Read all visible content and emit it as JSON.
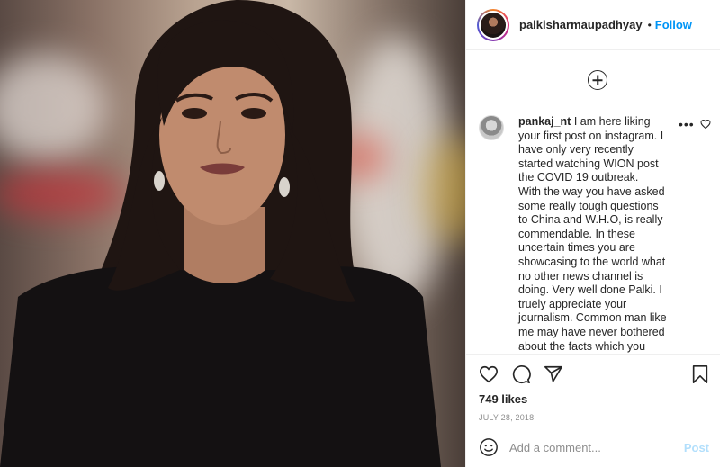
{
  "header": {
    "username": "palkisharmaupadhyay",
    "separator": "•",
    "follow_label": "Follow"
  },
  "comment": {
    "username": "pankaj_nt",
    "text": " I am here liking your first post on instagram. I have only very recently started watching WION post the COVID 19 outbreak.\nWith the way you have asked some really tough questions to China and W.H.O, is really commendable. In these uncertain times you are showcasing to the world what no other news channel is doing. Very well done Palki. I truely appreciate your journalism. Common man like me may have never bothered about the facts which you showcase everyday on your",
    "more_label": "•••"
  },
  "post": {
    "likes": "749 likes",
    "date": "JULY 28, 2018"
  },
  "add_comment": {
    "placeholder": "Add a comment...",
    "post_label": "Post"
  },
  "icons": {
    "load_more": "plus-circle-icon",
    "like": "heart-icon",
    "comment": "speech-bubble-icon",
    "share": "paper-plane-icon",
    "save": "bookmark-icon",
    "emoji": "smiley-icon"
  },
  "colors": {
    "accent": "#0095f6",
    "post_disabled": "#b2dffc",
    "text": "#262626",
    "muted": "#8e8e8e"
  }
}
